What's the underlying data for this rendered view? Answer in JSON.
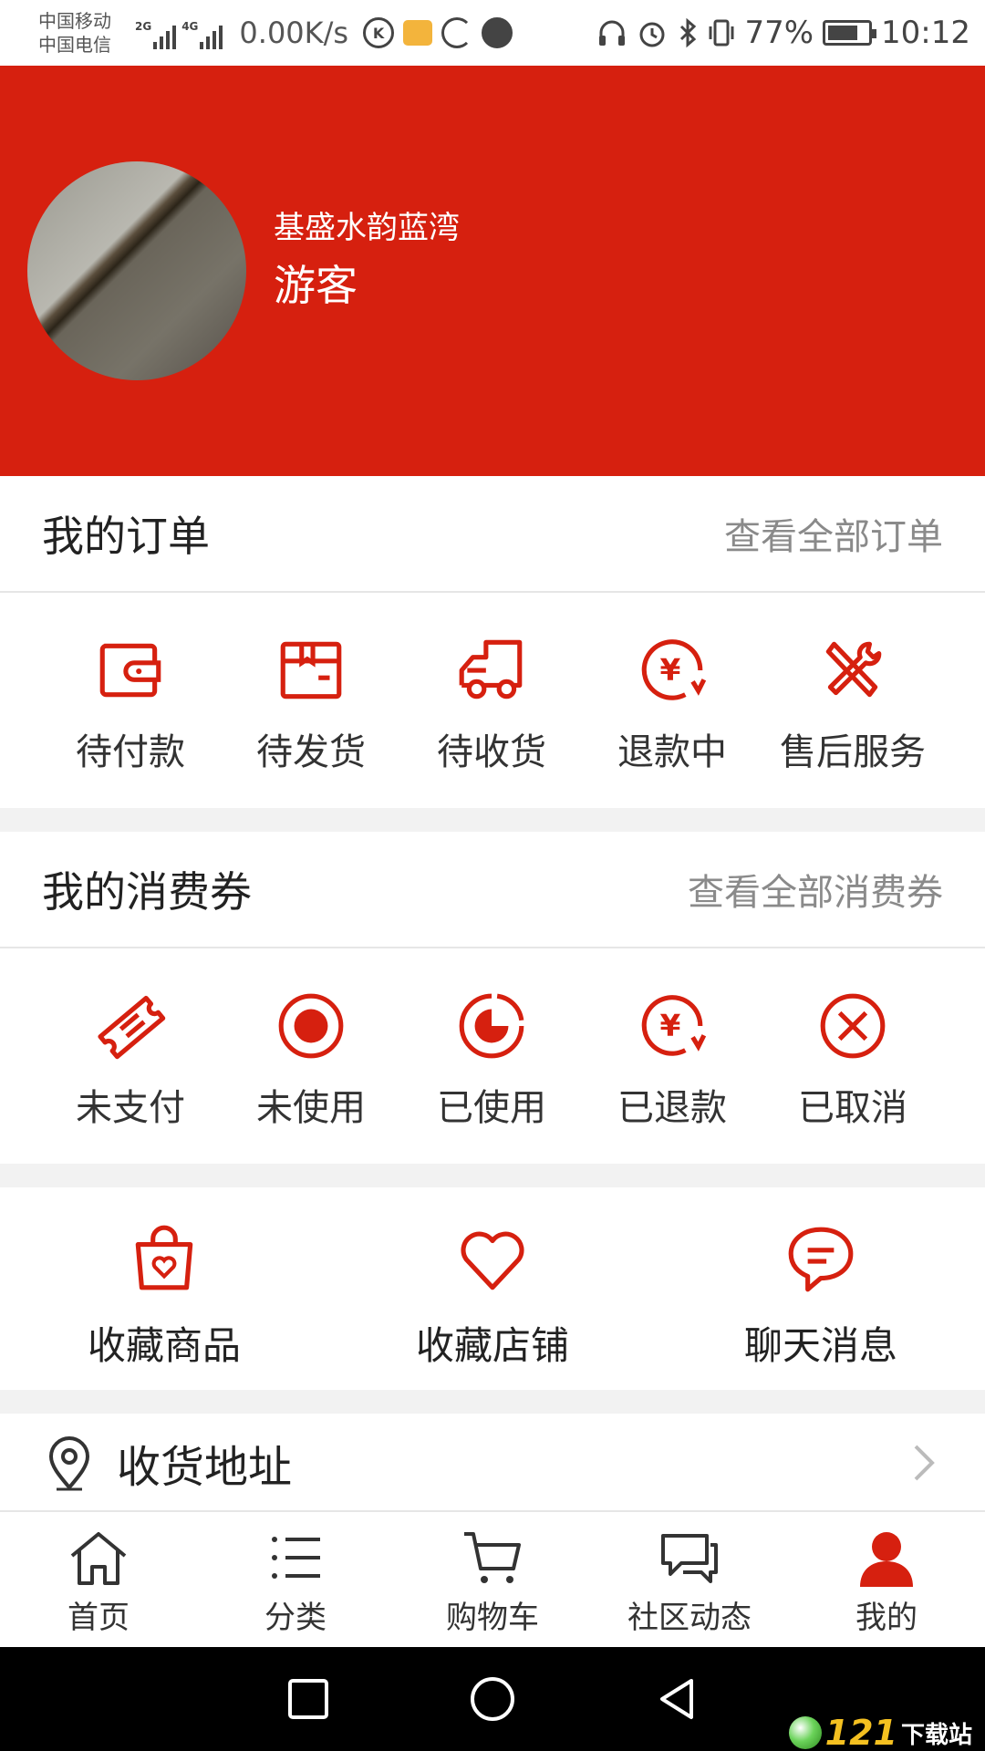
{
  "status_bar": {
    "carrier_1": "中国移动",
    "carrier_2": "中国电信",
    "sig1_label": "2G",
    "sig2_label": "4G",
    "net_speed": "0.00K/s",
    "battery": "77%",
    "time": "10:12"
  },
  "header": {
    "shop_name": "基盛水韵蓝湾",
    "user_name": "游客",
    "bg_color": "#d6200f"
  },
  "orders": {
    "title": "我的订单",
    "view_all": "查看全部订单",
    "items": [
      {
        "label": "待付款",
        "icon": "wallet-icon"
      },
      {
        "label": "待发货",
        "icon": "package-icon"
      },
      {
        "label": "待收货",
        "icon": "truck-icon"
      },
      {
        "label": "退款中",
        "icon": "refund-icon"
      },
      {
        "label": "售后服务",
        "icon": "tools-icon"
      }
    ]
  },
  "coupons": {
    "title": "我的消费券",
    "view_all": "查看全部消费券",
    "items": [
      {
        "label": "未支付",
        "icon": "ticket-icon"
      },
      {
        "label": "未使用",
        "icon": "record-icon"
      },
      {
        "label": "已使用",
        "icon": "pie-icon"
      },
      {
        "label": "已退款",
        "icon": "refund-icon"
      },
      {
        "label": "已取消",
        "icon": "cancel-icon"
      }
    ]
  },
  "favorites": {
    "items": [
      {
        "label": "收藏商品",
        "icon": "shopping-bag-heart-icon"
      },
      {
        "label": "收藏店铺",
        "icon": "heart-icon"
      },
      {
        "label": "聊天消息",
        "icon": "chat-bubble-icon"
      }
    ]
  },
  "address": {
    "label": "收货地址"
  },
  "tabbar": {
    "items": [
      {
        "label": "首页",
        "icon": "home-icon"
      },
      {
        "label": "分类",
        "icon": "list-icon"
      },
      {
        "label": "购物车",
        "icon": "cart-icon"
      },
      {
        "label": "社区动态",
        "icon": "chat-icon"
      },
      {
        "label": "我的",
        "icon": "user-icon"
      }
    ]
  },
  "watermark": {
    "num": "121",
    "text": "下载站"
  },
  "colors": {
    "accent": "#d6200f"
  }
}
